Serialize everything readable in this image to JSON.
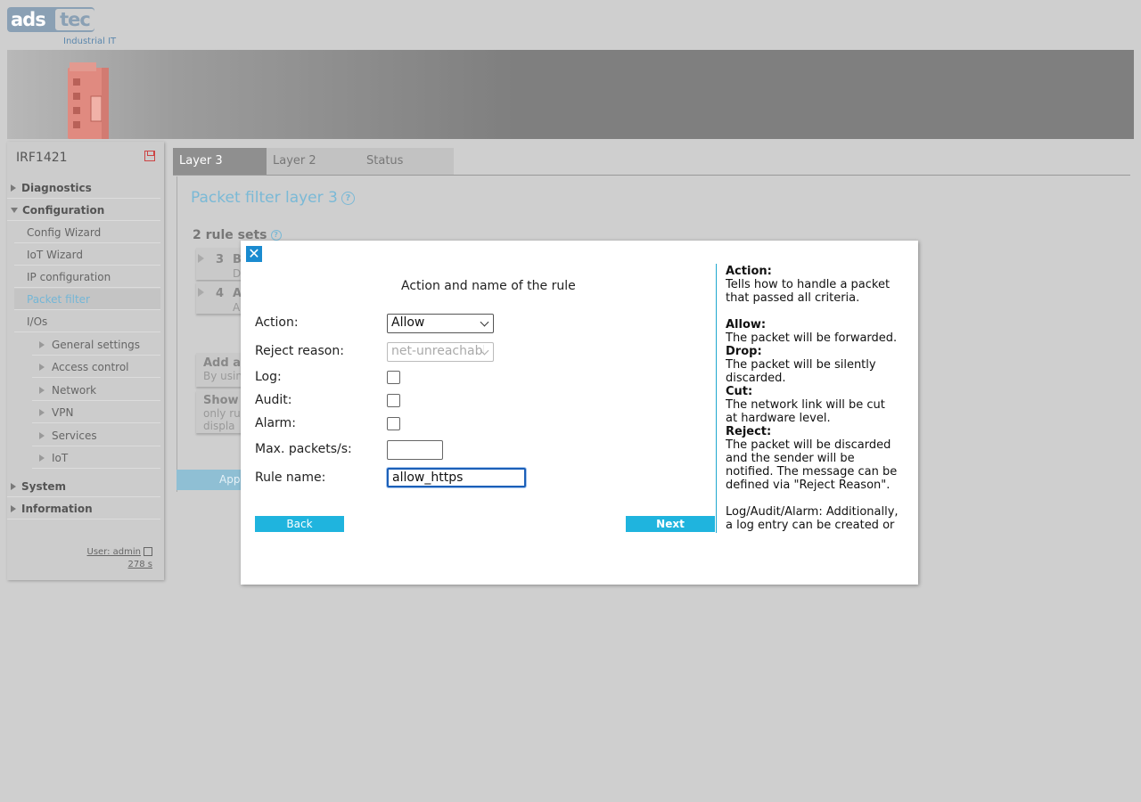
{
  "logo": {
    "brand_left": "ads",
    "brand_right": "tec",
    "tagline": "Industrial IT"
  },
  "sidebar": {
    "device_name": "IRF1421",
    "items": [
      {
        "label": "Diagnostics"
      },
      {
        "label": "Configuration"
      },
      {
        "label": "Config Wizard"
      },
      {
        "label": "IoT Wizard"
      },
      {
        "label": "IP configuration"
      },
      {
        "label": "Packet filter"
      },
      {
        "label": "I/Os"
      },
      {
        "label": "General settings"
      },
      {
        "label": "Access control"
      },
      {
        "label": "Network"
      },
      {
        "label": "VPN"
      },
      {
        "label": "Services"
      },
      {
        "label": "IoT"
      },
      {
        "label": "System"
      },
      {
        "label": "Information"
      }
    ],
    "user": "User: admin",
    "timer": "278 s"
  },
  "tabs": [
    {
      "label": "Layer 3"
    },
    {
      "label": "Layer 2"
    },
    {
      "label": "Status"
    }
  ],
  "main": {
    "title": "Packet filter layer 3",
    "rule_sets_heading": "2 rule sets",
    "rule_sets": [
      {
        "num": "3",
        "name": "B",
        "desc": "D"
      },
      {
        "num": "4",
        "name": "A",
        "desc": "A"
      }
    ],
    "add_title": "Add a",
    "add_text": "By usin",
    "show_title": "Show",
    "show_text1": "only ru",
    "show_text2": "displa",
    "apply_label": "Appl"
  },
  "dialog": {
    "close_glyph": "✕",
    "title": "Action and name of the rule",
    "labels": {
      "action": "Action:",
      "reject_reason": "Reject reason:",
      "log": "Log:",
      "audit": "Audit:",
      "alarm": "Alarm:",
      "max_packets": "Max. packets/s:",
      "rule_name": "Rule name:"
    },
    "values": {
      "action": "Allow",
      "reject_reason": "net-unreachable",
      "max_packets": "",
      "rule_name": "allow_https"
    },
    "back_label": "Back",
    "next_label": "Next",
    "help": {
      "h_action": "Action:",
      "t_action": "Tells how to handle a packet that passed all criteria.",
      "h_allow": "Allow:",
      "t_allow": "The packet will be forwarded.",
      "h_drop": "Drop:",
      "t_drop": "The packet will be silently discarded.",
      "h_cut": "Cut:",
      "t_cut": "The network link will be cut at hardware level.",
      "h_reject": "Reject:",
      "t_reject": "The packet will be discarded and the sender will be notified. The message can be defined via \"Reject Reason\".",
      "t_log": "Log/Audit/Alarm: Additionally, a log entry can be created or the"
    }
  }
}
